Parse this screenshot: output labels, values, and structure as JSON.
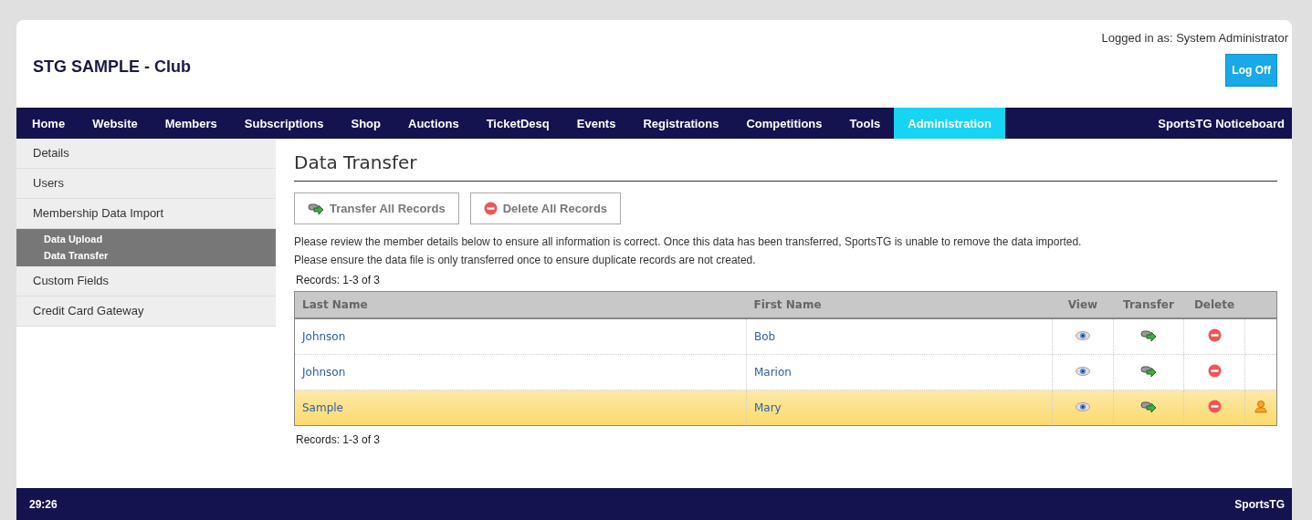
{
  "header": {
    "title": "STG SAMPLE - Club",
    "login_text": "Logged in as: System Administrator",
    "logoff_button": "Log Off"
  },
  "nav": {
    "items": [
      {
        "label": "Home",
        "selected": false
      },
      {
        "label": "Website",
        "selected": false
      },
      {
        "label": "Members",
        "selected": false
      },
      {
        "label": "Subscriptions",
        "selected": false
      },
      {
        "label": "Shop",
        "selected": false
      },
      {
        "label": "Auctions",
        "selected": false
      },
      {
        "label": "TicketDesq",
        "selected": false
      },
      {
        "label": "Events",
        "selected": false
      },
      {
        "label": "Registrations",
        "selected": false
      },
      {
        "label": "Competitions",
        "selected": false
      },
      {
        "label": "Tools",
        "selected": false
      },
      {
        "label": "Administration",
        "selected": true
      }
    ],
    "right_link": "SportsTG Noticeboard"
  },
  "sidebar": {
    "items": [
      {
        "label": "Details"
      },
      {
        "label": "Users"
      },
      {
        "label": "Membership Data Import",
        "children": [
          {
            "label": "Data Upload"
          },
          {
            "label": "Data Transfer"
          }
        ]
      },
      {
        "label": "Custom Fields"
      },
      {
        "label": "Credit Card Gateway"
      }
    ]
  },
  "content": {
    "title": "Data Transfer",
    "buttons": [
      {
        "kind": "transfer",
        "label": "Transfer All Records"
      },
      {
        "kind": "delete",
        "label": "Delete All Records"
      }
    ],
    "notes": [
      "Please review the member details below to ensure all information is correct. Once this data has been transferred, SportsTG is unable to remove the data imported.",
      "Please ensure the data file is only transferred once to ensure duplicate records are not created."
    ],
    "records_top": "Records: 1-3 of 3",
    "table": {
      "columns": [
        "Last Name",
        "First Name",
        "View",
        "Transfer",
        "Delete"
      ],
      "rows": [
        {
          "last_name": "Johnson",
          "first_name": "Bob",
          "selected": false
        },
        {
          "last_name": "Johnson",
          "first_name": "Marion",
          "selected": false
        },
        {
          "last_name": "Sample",
          "first_name": "Mary",
          "selected": true
        }
      ]
    },
    "records_bottom": "Records: 1-3 of 3"
  },
  "footer": {
    "left": "29:26",
    "right": "SportsTG"
  }
}
